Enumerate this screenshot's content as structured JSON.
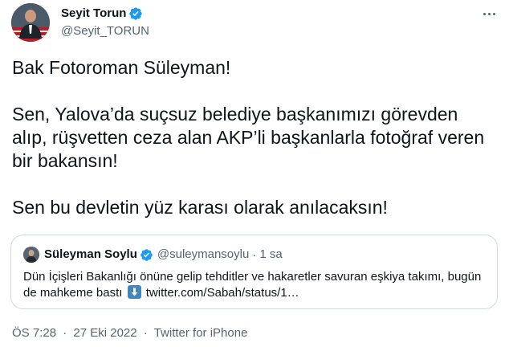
{
  "author": {
    "name": "Seyit Torun",
    "handle": "@Seyit_TORUN"
  },
  "tweet": {
    "paragraphs": [
      "Bak Fotoroman Süleyman!",
      "Sen, Yalova’da suçsuz belediye başkanımızı görevden alıp, rüşvetten ceza alan AKP’li başkanlarla fotoğraf veren bir bakansın!",
      "Sen bu devletin yüz karası olarak anılacaksın!"
    ]
  },
  "quoted": {
    "name": "Süleyman Soylu",
    "handle": "@suleymansoylu",
    "separator": "·",
    "time": "1 sa",
    "text_before_emoji": "Dün İçişleri Bakanlığı önüne gelip tehditler ve hakaretler savuran eşkiya takımı, bugün de mahkeme bastı",
    "emoji": "down-arrow-emoji",
    "link": "twitter.com/Sabah/status/1…"
  },
  "meta": {
    "time": "ÖS 7:28",
    "separator": "·",
    "date": "27 Eki 2022",
    "source": "Twitter for iPhone"
  },
  "colors": {
    "verified": "#1d9bf0",
    "secondary_text": "#536471",
    "link": "#0f1419",
    "border": "#cfd9de"
  },
  "icons": [
    "verified-badge-icon",
    "more-options-icon",
    "down-arrow-emoji-icon"
  ]
}
